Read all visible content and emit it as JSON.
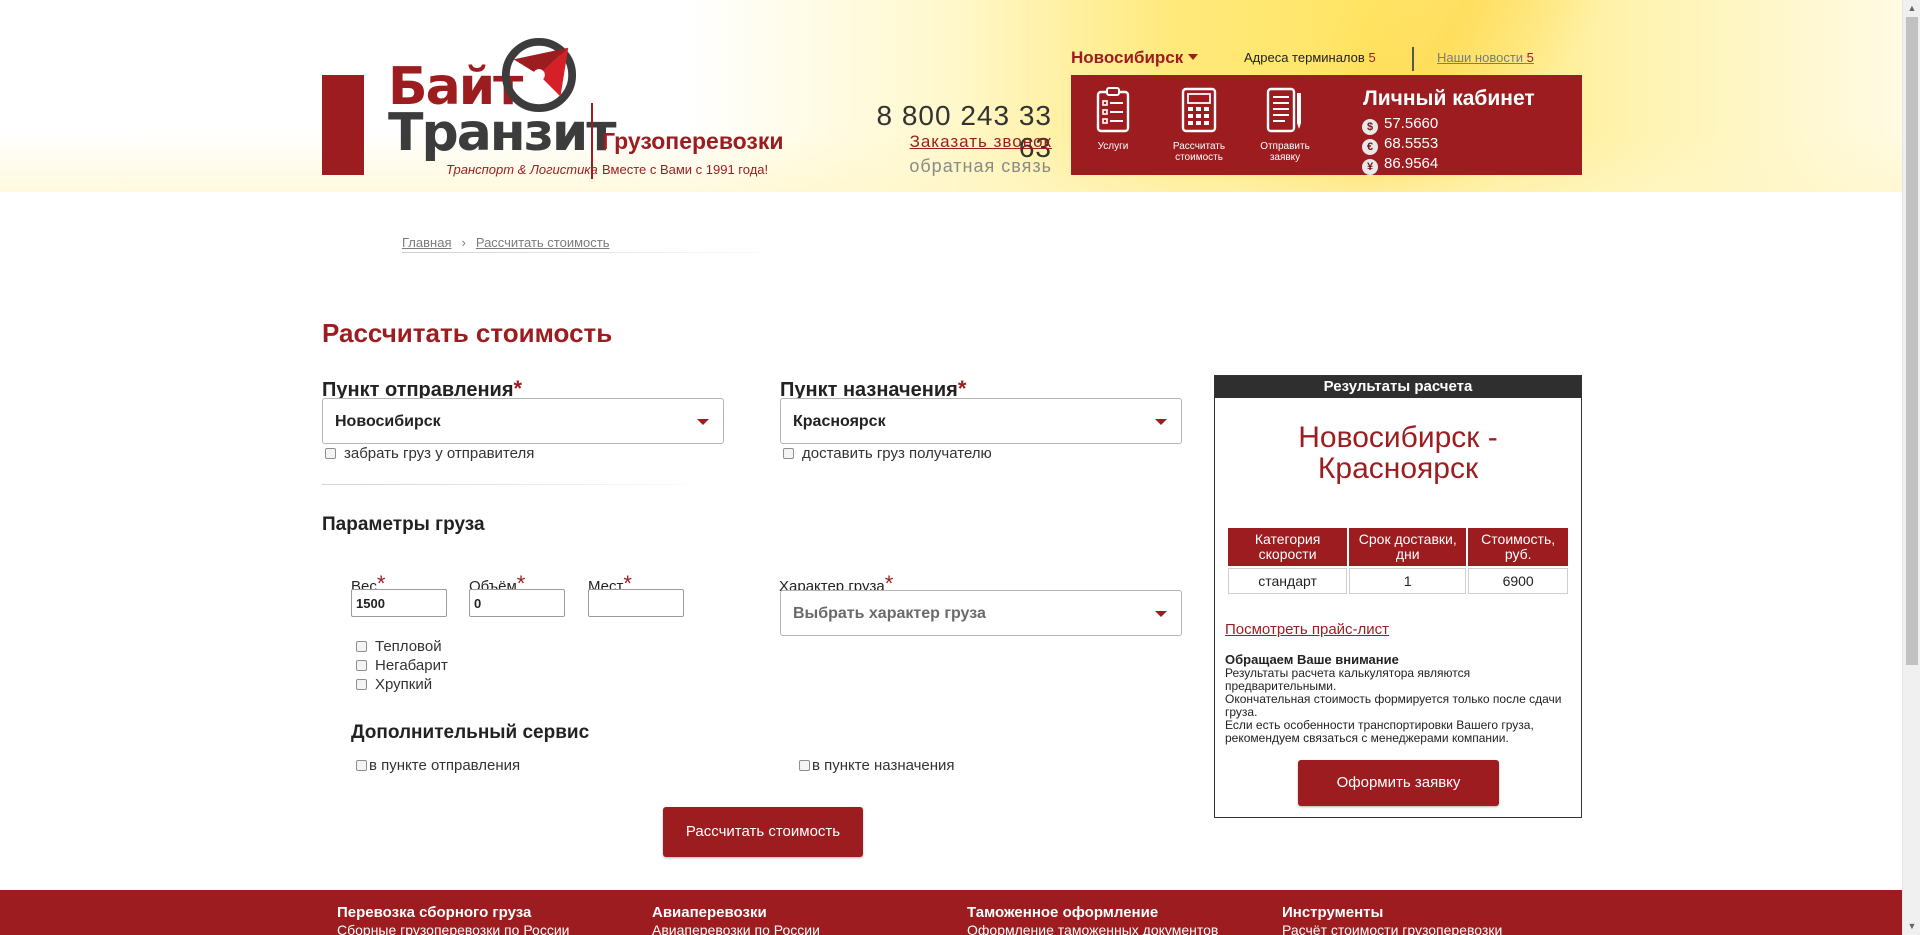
{
  "header": {
    "logo": {
      "line1": "Байт",
      "line2": "Транзит",
      "tagline": "Транспорт & Логистика",
      "cargo": "Грузоперевозки",
      "slogan": "Вместе с Вами с 1991 года!"
    },
    "phone": "8 800 243 33 63",
    "order_call": "Заказать звонок",
    "feedback": "обратная связь",
    "city": "Новосибирск",
    "terminals_label": "Адреса терминалов",
    "terminals_count": "5",
    "news_label": "Наши новости",
    "news_count": "5",
    "quick_buttons": [
      {
        "label": "Услуги",
        "icon": "clipboard-checklist-icon"
      },
      {
        "label": "Рассчитать стоимость",
        "icon": "calculator-icon"
      },
      {
        "label": "Отправить заявку",
        "icon": "document-pen-icon"
      }
    ],
    "cabinet": "Личный кабинет",
    "rates": [
      {
        "symbol": "$",
        "value": "57.5660"
      },
      {
        "symbol": "€",
        "value": "68.5553"
      },
      {
        "symbol": "¥",
        "value": "86.9564"
      }
    ]
  },
  "breadcrumb": {
    "home": "Главная",
    "separator": "›",
    "current": "Рассчитать стоимость"
  },
  "page_title": "Рассчитать стоимость",
  "form": {
    "origin": {
      "label": "Пункт отправления",
      "required": "*",
      "value": "Новосибирск",
      "checkbox": "забрать груз у отправителя"
    },
    "destination": {
      "label": "Пункт назначения",
      "required": "*",
      "value": "Красноярск",
      "checkbox": "доставить груз получателю"
    },
    "cargo_params_title": "Параметры груза",
    "weight": {
      "label": "Вес",
      "required": "*",
      "value": "1500"
    },
    "volume": {
      "label": "Объём",
      "required": "*",
      "value": "0"
    },
    "places": {
      "label": "Мест",
      "required": "*",
      "value": ""
    },
    "cargo_type": {
      "label": "Характер груза",
      "required": "*",
      "placeholder": "Выбрать характер груза"
    },
    "options": [
      "Тепловой",
      "Негабарит",
      "Хрупкий"
    ],
    "extra_service_title": "Дополнительный сервис",
    "extra_origin": "в пункте отправления",
    "extra_destination": "в пункте назначения",
    "submit": "Рассчитать стоимость"
  },
  "results": {
    "title": "Результаты расчета",
    "route_line1": "Новосибирск -",
    "route_line2": "Красноярск",
    "columns": [
      "Категория скорости",
      "Срок доставки, дни",
      "Стоимость, руб."
    ],
    "rows": [
      [
        "стандарт",
        "1",
        "6900"
      ]
    ],
    "pricelist_link": "Посмотреть прайс-лист",
    "notice_title": "Обращаем Ваше внимание",
    "notice_lines": [
      "Результаты расчета калькулятора являются предварительными.",
      "Окончательная стоимость формируется только после сдачи груза.",
      "Если есть особенности транспортировки Вашего груза, рекомендуем связаться с менеджерами компании."
    ],
    "order_button": "Оформить заявку"
  },
  "footer": [
    {
      "title": "Перевозка сборного груза",
      "link": "Сборные грузоперевозки по России"
    },
    {
      "title": "Авиаперевозки",
      "link": "Авиаперевозки по России"
    },
    {
      "title": "Таможенное оформление",
      "link": "Оформление таможенных документов"
    },
    {
      "title": "Инструменты",
      "link": "Расчёт стоимости грузоперевозки"
    }
  ],
  "colors": {
    "brand_red": "#9c1c1f",
    "dark": "#2f2f2f",
    "header_yellow": "#ffe566"
  }
}
